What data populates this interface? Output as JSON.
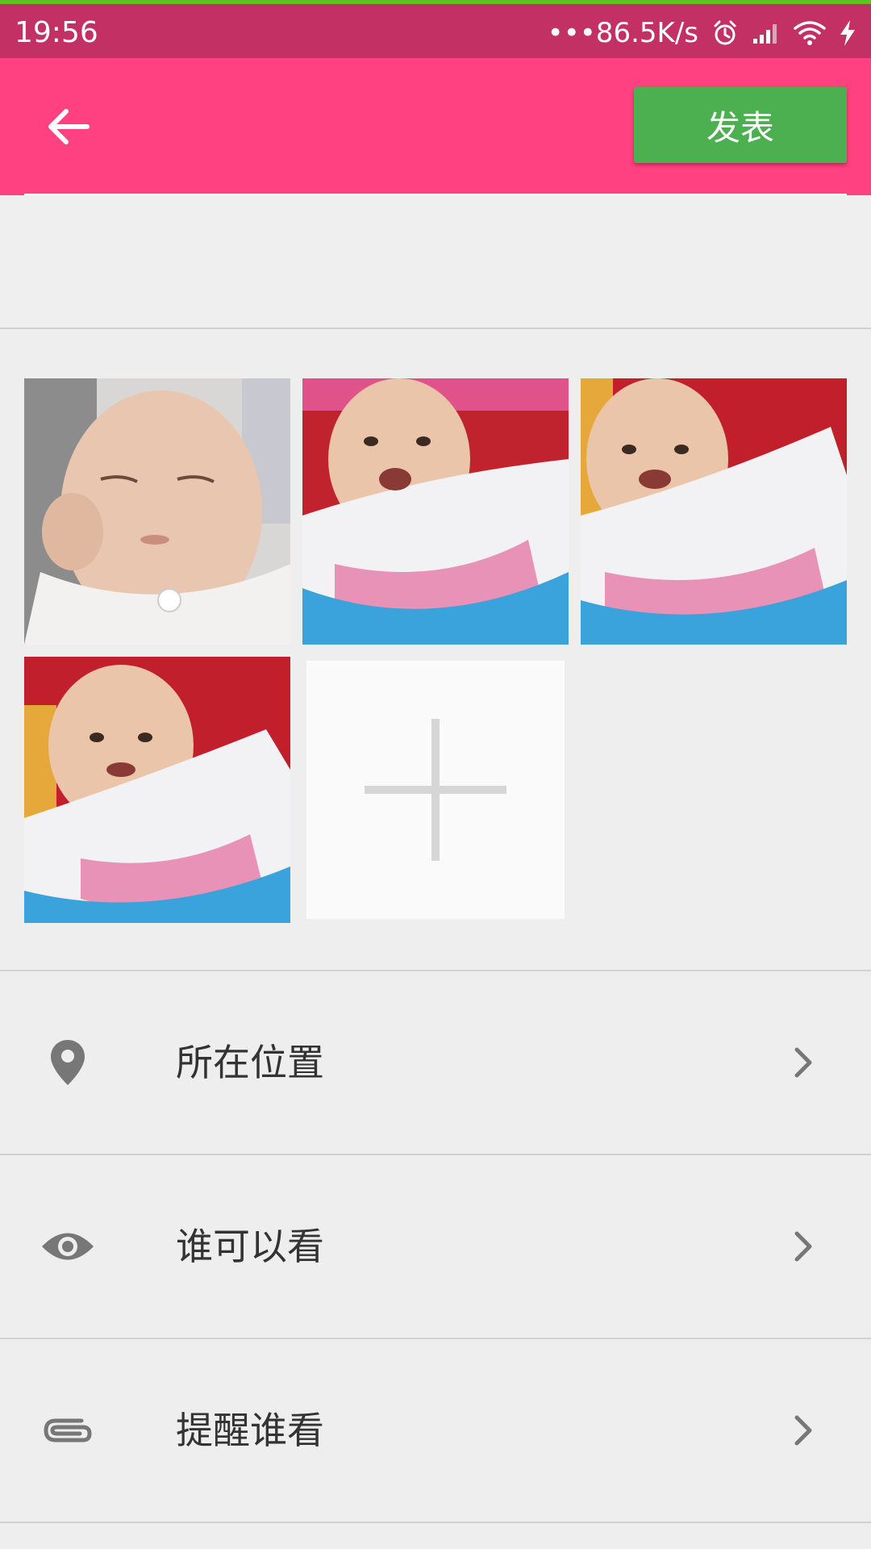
{
  "status_bar": {
    "time": "19:56",
    "network_speed": "•••86.5K/s",
    "icons": [
      "alarm-icon",
      "signal-icon",
      "wifi-icon",
      "charging-icon"
    ],
    "background": "#c33063"
  },
  "app_bar": {
    "back_icon": "arrow-left-icon",
    "publish_label": "发表",
    "background": "#ff4081",
    "publish_color": "#4caf50"
  },
  "post": {
    "text_value": "",
    "photos": [
      "baby-photo-1",
      "baby-photo-2",
      "baby-photo-3",
      "baby-photo-4"
    ],
    "add_photo_icon": "plus-icon"
  },
  "menu": {
    "items": [
      {
        "icon": "location-pin-icon",
        "label": "所在位置"
      },
      {
        "icon": "eye-icon",
        "label": "谁可以看"
      },
      {
        "icon": "paperclip-icon",
        "label": "提醒谁看"
      }
    ]
  }
}
